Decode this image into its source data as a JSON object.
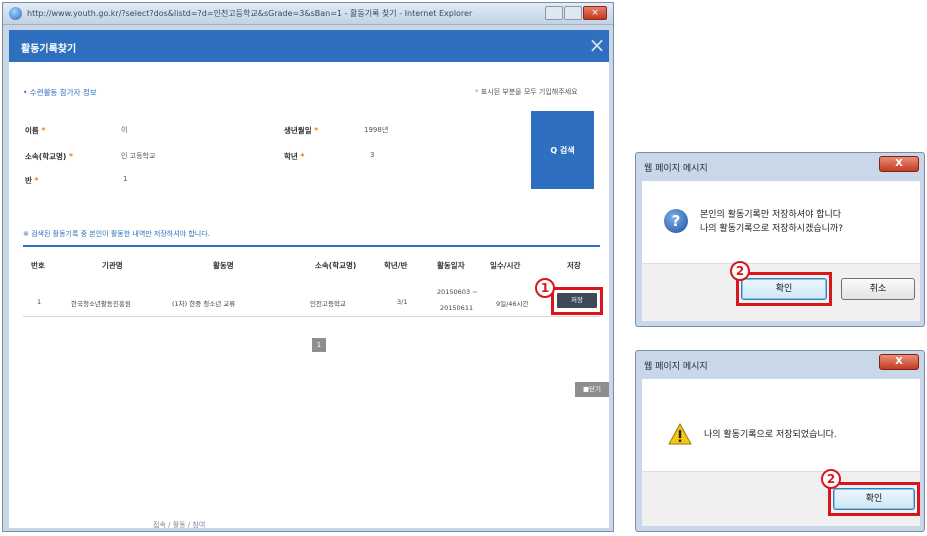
{
  "browser": {
    "title": "http://www.youth.go.kr/?select?dos&listd=?d=인천고등학교&sGrade=3&sBan=1 - 활동기록 찾기 - Internet Explorer"
  },
  "modal": {
    "title": "활동기록찾기",
    "close_icon": "×",
    "section_heading": "• 수련활동 참가자 정보",
    "required_note": "표시된 부분을 모두 기입해주세요",
    "required_mark": "*",
    "fields": {
      "name_label": "이름",
      "name_value": "이",
      "birth_label": "생년월일",
      "birth_value": "1998년",
      "school_label": "소속(학교명)",
      "school_value": "인  고등학교",
      "grade_label": "학년",
      "grade_value": "3",
      "class_label": "반",
      "class_value": "1"
    },
    "search_button": "Q 검색",
    "list_heading": "※ 검색된 활동기록 중 본인이 활동한 내역만 저장하셔야 합니다.",
    "table": {
      "headers": [
        "번호",
        "기관명",
        "활동명",
        "소속(학교명)",
        "학년/반",
        "활동일자",
        "일수/시간",
        "저장"
      ],
      "row": {
        "no": "1",
        "org": "한국청소년활동진흥원",
        "activity": "(1차) 한중 청소년 교류",
        "school": "인천고등학교",
        "grade_class": "3/1",
        "date_line1": "20150603 ~",
        "date_line2": "20150611",
        "days_hours": "9일/46시간",
        "save_button": "저장"
      }
    },
    "pagination_current": "1",
    "close_button": "■닫기",
    "callout_number": "1"
  },
  "bottom_text": "접속 / 활동 / 참여",
  "dialog_confirm": {
    "title": "웹 페이지 메시지",
    "close_icon": "X",
    "icon": "question-icon",
    "message_line1": "본인의 활동기록만 저장하셔야 합니다",
    "message_line2": "나의 활동기록으로 저장하시겠습니까?",
    "ok_button": "확인",
    "cancel_button": "취소",
    "callout_number": "2"
  },
  "dialog_saved": {
    "title": "웹 페이지 메시지",
    "close_icon": "X",
    "icon": "warning-icon",
    "message": "나의 활동기록으로 저장되었습니다.",
    "ok_button": "확인",
    "callout_number": "2"
  },
  "colors": {
    "brand_blue": "#2f6fbf",
    "highlight_red": "#d9161e",
    "required_orange": "#e67e22"
  }
}
